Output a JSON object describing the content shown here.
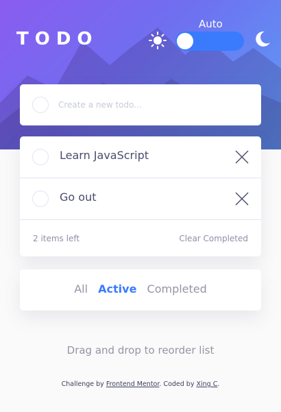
{
  "header": {
    "title": "TODO",
    "theme_label": "Auto",
    "icons": {
      "light": "sun-icon",
      "dark": "moon-icon"
    }
  },
  "new_todo": {
    "placeholder": "Create a new todo..."
  },
  "todos": [
    {
      "text": "Learn JavaScript",
      "completed": false
    },
    {
      "text": "Go out",
      "completed": false
    }
  ],
  "footer": {
    "items_left": "2 items left",
    "clear_label": "Clear Completed"
  },
  "filters": {
    "all": "All",
    "active": "Active",
    "completed": "Completed",
    "selected": "Active"
  },
  "hint": "Drag and drop to reorder list",
  "attribution": {
    "prefix": "Challenge by ",
    "link1": "Frontend Mentor",
    "middle": ". Coded by ",
    "link2": "Xing C",
    "suffix": "."
  },
  "colors": {
    "accent": "#3a7bfd",
    "gradient_start": "#8a5cf0",
    "gradient_end": "#5aa0f5"
  }
}
